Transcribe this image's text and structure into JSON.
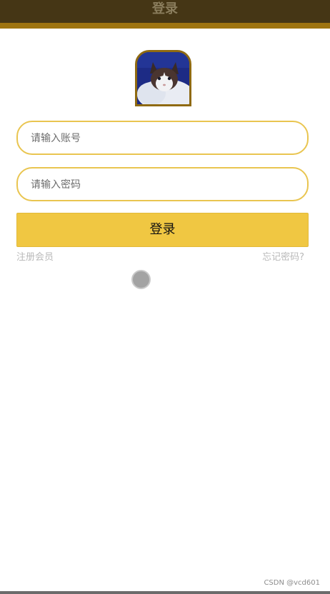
{
  "header": {
    "title": "登录"
  },
  "avatar": {
    "alt": "cat-photo"
  },
  "form": {
    "account_placeholder": "请输入账号",
    "password_placeholder": "请输入密码",
    "account_value": "",
    "password_value": ""
  },
  "actions": {
    "login_label": "登录",
    "register_label": "注册会员",
    "forgot_label": "忘记密码?"
  },
  "footer": {
    "watermark": "CSDN @vcd601"
  },
  "colors": {
    "header_bg": "#453615",
    "header_strip": "#9e7410",
    "accent": "#f0c742",
    "field_border": "#e9c550",
    "link": "#b9b9b9"
  },
  "icons": {
    "loading": "loading-spinner-icon"
  }
}
